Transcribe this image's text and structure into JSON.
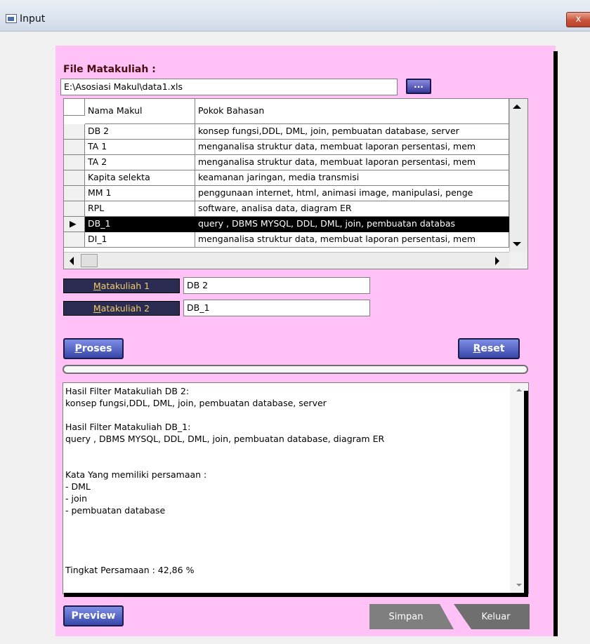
{
  "window": {
    "title": "Input",
    "close_label": "x"
  },
  "file": {
    "label": "File Matakuliah :",
    "path": "E:\\Asosiasi Makul\\data1.xls",
    "browse_label": "..."
  },
  "grid": {
    "columns": [
      "Nama Makul",
      "Pokok Bahasan"
    ],
    "rows": [
      {
        "nama": "DB 2",
        "pokok": "konsep fungsi,DDL, DML, join, pembuatan database, server"
      },
      {
        "nama": "TA 1",
        "pokok": "menganalisa struktur data, membuat laporan persentasi, mem"
      },
      {
        "nama": "TA 2",
        "pokok": "menganalisa struktur data, membuat laporan persentasi, mem"
      },
      {
        "nama": "Kapita  selekta",
        "pokok": "keamanan jaringan, media transmisi"
      },
      {
        "nama": "MM 1",
        "pokok": "penggunaan internet, html, animasi image, manipulasi, penge"
      },
      {
        "nama": "RPL",
        "pokok": "software, analisa data, diagram ER"
      },
      {
        "nama": "DB_1",
        "pokok": "query , DBMS MYSQL, DDL, DML, join, pembuatan databas"
      },
      {
        "nama": "DI_1",
        "pokok": "menganalisa struktur data, membuat laporan persentasi, mem"
      }
    ],
    "selected_indicator": "▶"
  },
  "matakuliah1": {
    "label": "Matakuliah 1",
    "value": "DB 2"
  },
  "matakuliah2": {
    "label": "Matakuliah 2",
    "value": "DB_1"
  },
  "buttons": {
    "proses": "Proses",
    "reset": "Reset",
    "preview": "Preview",
    "simpan": "Simpan",
    "keluar": "Keluar"
  },
  "result_lines": [
    "Hasil Filter Matakuliah DB 2:",
    "konsep fungsi,DDL, DML, join, pembuatan database, server",
    "",
    "Hasil Filter Matakuliah DB_1:",
    "query , DBMS MYSQL, DDL, DML, join, pembuatan database, diagram ER",
    "",
    "",
    "Kata Yang memiliki persamaan :",
    "- DML",
    "- join",
    "- pembuatan database",
    "",
    "",
    "",
    "",
    "Tingkat Persamaan : 42,86 %"
  ],
  "colors": {
    "panel": "#ffc1f6",
    "label_bg": "#2c2c52",
    "label_text": "#f0ce6a",
    "title_text": "#4a0d14"
  }
}
